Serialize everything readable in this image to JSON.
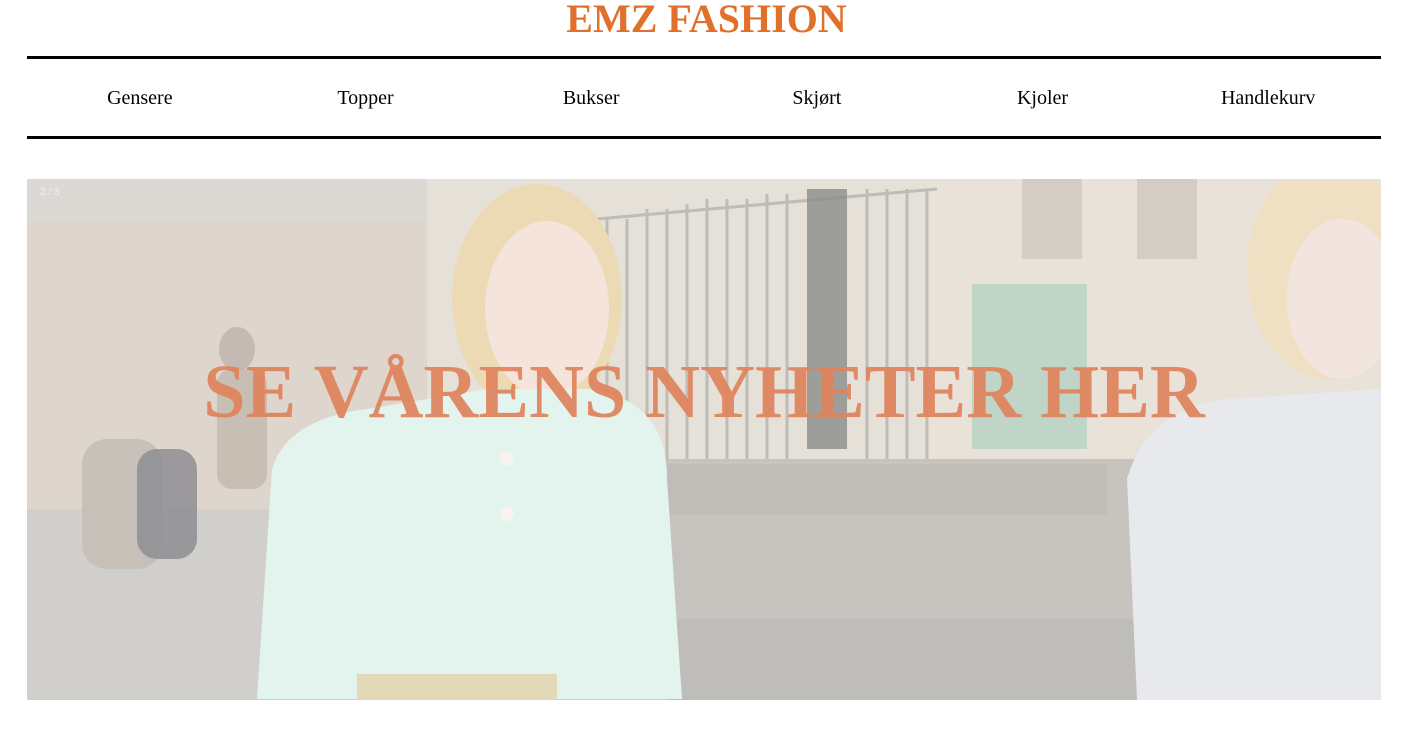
{
  "header": {
    "title": "EMZ FASHION"
  },
  "nav": {
    "items": [
      {
        "label": "Gensere"
      },
      {
        "label": "Topper"
      },
      {
        "label": "Bukser"
      },
      {
        "label": "Skjørt"
      },
      {
        "label": "Kjoler"
      },
      {
        "label": "Handlekurv"
      }
    ]
  },
  "hero": {
    "slide_counter": "2 / 3",
    "caption": "SE VÅRENS NYHETER HER",
    "image": "street-style-photo"
  },
  "colors": {
    "brand": "#e0702a",
    "caption": "#e0835c",
    "divider": "#000000"
  }
}
